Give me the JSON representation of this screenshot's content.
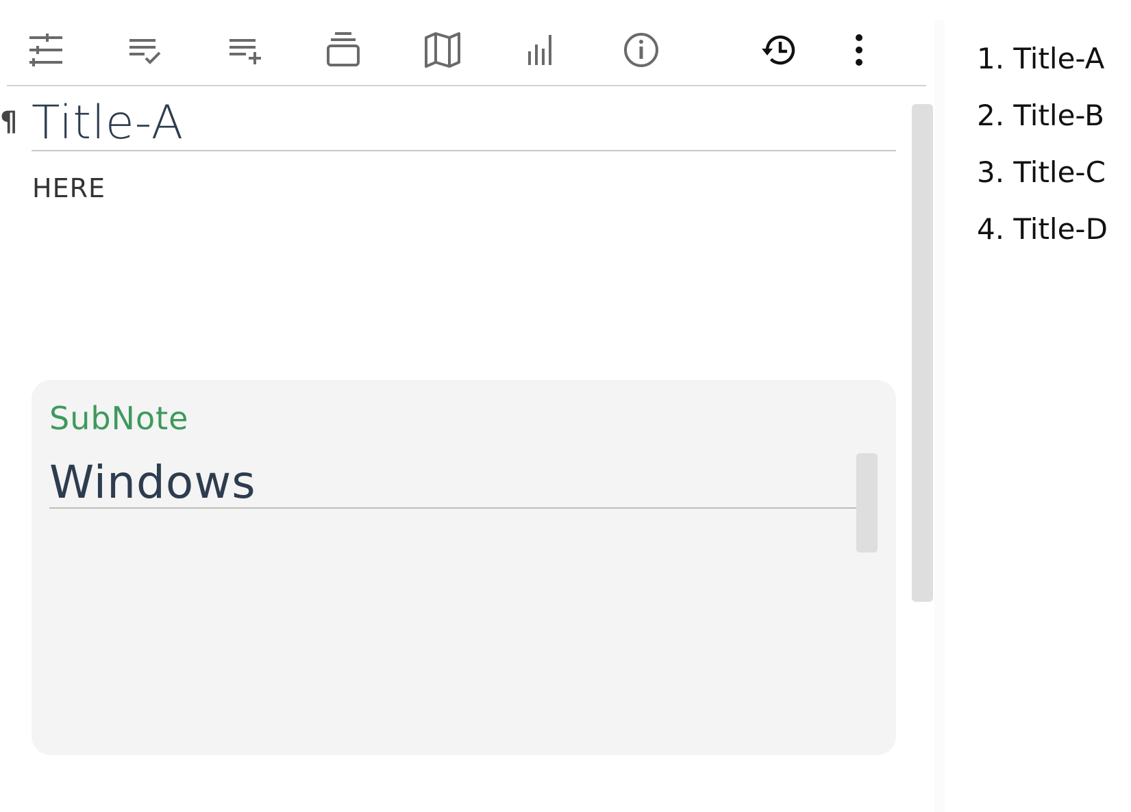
{
  "toolbar": {
    "icons": {
      "settings": "tune-sliders-icon",
      "checklist": "checklist-icon",
      "add_list": "playlist-add-icon",
      "stack": "stack-icon",
      "map": "map-icon",
      "stats": "bar-chart-icon",
      "info": "info-icon",
      "history": "history-icon",
      "more": "more-vertical-icon"
    }
  },
  "note": {
    "title": "Title-A",
    "body": "HERE",
    "pilcrow": "¶"
  },
  "subnote": {
    "label": "SubNote",
    "title": "Windows"
  },
  "toc": {
    "items": [
      "1. Title-A",
      "2. Title-B",
      "3. Title-C",
      "4. Title-D"
    ]
  },
  "colors": {
    "toolbar_icon": "#6a6a6a",
    "title_text": "#2d3c4e",
    "subnote_label": "#3d9a5c",
    "subnote_bg": "#f4f4f4",
    "scrollbar": "#dedede"
  }
}
